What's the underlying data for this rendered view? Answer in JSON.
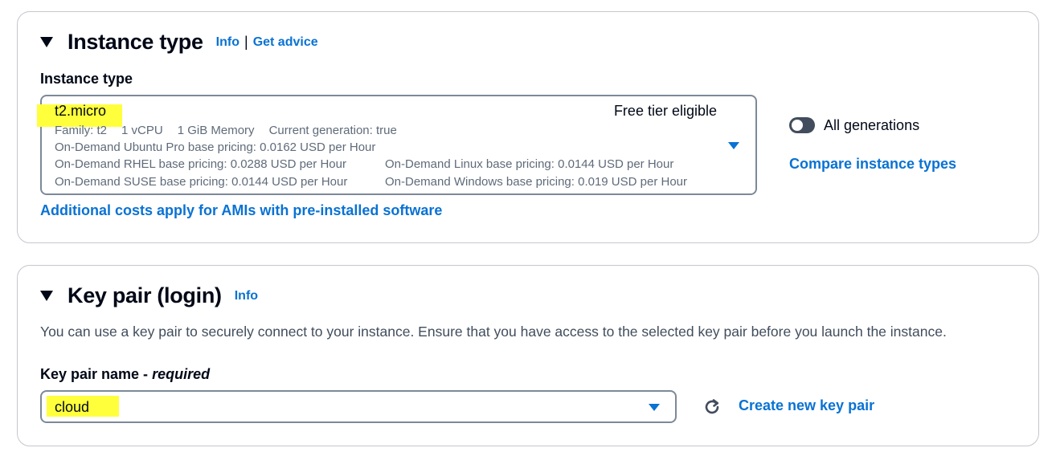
{
  "instance_type_section": {
    "title": "Instance type",
    "info_link": "Info",
    "separator": "|",
    "get_advice_link": "Get advice",
    "field_label": "Instance type",
    "selected": {
      "name": "t2.micro",
      "free_tier": "Free tier eligible",
      "family": "Family: t2",
      "vcpu": "1 vCPU",
      "memory": "1 GiB Memory",
      "generation": "Current generation: true",
      "ubuntu_pro_pricing": "On-Demand Ubuntu Pro base pricing: 0.0162 USD per Hour",
      "rhel_pricing": "On-Demand RHEL base pricing: 0.0288 USD per Hour",
      "linux_pricing": "On-Demand Linux base pricing: 0.0144 USD per Hour",
      "suse_pricing": "On-Demand SUSE base pricing: 0.0144 USD per Hour",
      "windows_pricing": "On-Demand Windows base pricing: 0.019 USD per Hour"
    },
    "all_generations_toggle": {
      "label": "All generations",
      "enabled": false
    },
    "compare_link": "Compare instance types",
    "additional_costs_link": "Additional costs apply for AMIs with pre-installed software"
  },
  "key_pair_section": {
    "title": "Key pair (login)",
    "info_link": "Info",
    "description": "You can use a key pair to securely connect to your instance. Ensure that you have access to the selected key pair before you launch the instance.",
    "field_label": "Key pair name - ",
    "field_label_required": "required",
    "selected_value": "cloud",
    "refresh_icon": "refresh-icon",
    "create_link": "Create new key pair"
  },
  "colors": {
    "link": "#0972d3",
    "text": "#000716",
    "secondary_text": "#5f6b7a",
    "highlight": "#ffff3c",
    "border": "#7d8998"
  }
}
